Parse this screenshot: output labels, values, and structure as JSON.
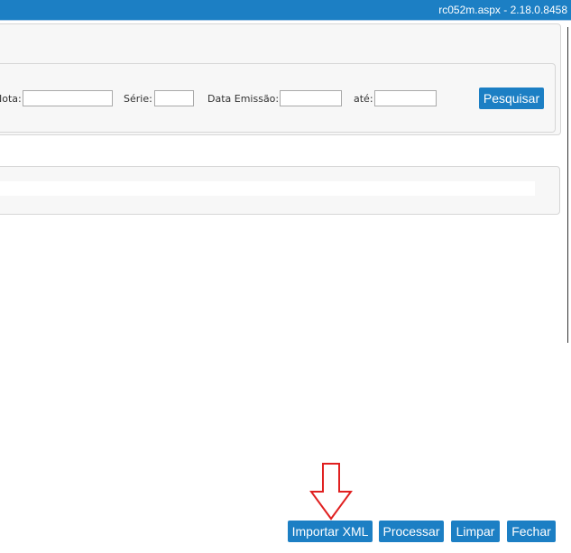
{
  "header": {
    "version_text": "rc052m.aspx - 2.18.0.8458"
  },
  "filter": {
    "nota_label": "Nota:",
    "serie_label": "Série:",
    "data_emissao_label": "Data Emissão:",
    "ate_label": "até:",
    "nota_value": "",
    "serie_value": "",
    "data_emissao_value": "",
    "ate_value": "",
    "search_button": "Pesquisar"
  },
  "actions": {
    "importar_xml": "Importar XML",
    "processar": "Processar",
    "limpar": "Limpar",
    "fechar": "Fechar"
  },
  "colors": {
    "accent": "#1c7fc4",
    "arrow": "#e02020"
  }
}
